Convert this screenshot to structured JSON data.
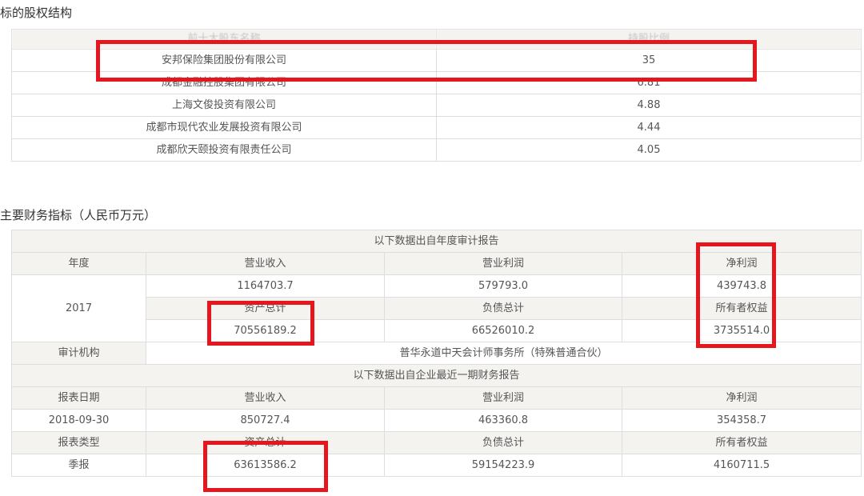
{
  "shareholder_section": {
    "title": "标的股权结构",
    "columns": [
      "前十大股东名称",
      "持股比例"
    ],
    "rows": [
      {
        "name": "安邦保险集团股份有限公司",
        "ratio": "35"
      },
      {
        "name": "成都金融控股集团有限公司",
        "ratio": "6.81"
      },
      {
        "name": "上海文俊投资有限公司",
        "ratio": "4.88"
      },
      {
        "name": "成都市现代农业发展投资有限公司",
        "ratio": "4.44"
      },
      {
        "name": "成都欣天颐投资有限责任公司",
        "ratio": "4.05"
      }
    ]
  },
  "financial_section": {
    "title": "主要财务指标（人民币万元）",
    "annual": {
      "banner": "以下数据出自年度审计报告",
      "year_label": "年度",
      "year": "2017",
      "h_revenue": "营业收入",
      "h_op_profit": "营业利润",
      "h_net_profit": "净利润",
      "revenue": "1164703.7",
      "op_profit": "579793.0",
      "net_profit": "439743.8",
      "h_total_assets": "资产总计",
      "h_total_liab": "负债总计",
      "h_equity": "所有者权益",
      "total_assets": "70556189.2",
      "total_liab": "66526010.2",
      "equity": "3735514.0",
      "auditor_label": "审计机构",
      "auditor": "普华永道中天会计师事务所（特殊普通合伙）"
    },
    "latest": {
      "banner": "以下数据出自企业最近一期财务报告",
      "date_label": "报表日期",
      "h_revenue": "营业收入",
      "h_op_profit": "营业利润",
      "h_net_profit": "净利润",
      "date": "2018-09-30",
      "revenue": "850727.4",
      "op_profit": "463360.8",
      "net_profit": "354358.7",
      "type_label": "报表类型",
      "h_total_assets": "资产总计",
      "h_total_liab": "负债总计",
      "h_equity": "所有者权益",
      "type": "季报",
      "total_assets": "63613586.2",
      "total_liab": "59154223.9",
      "equity": "4160711.5"
    }
  },
  "annotation_color": "#e5161d"
}
